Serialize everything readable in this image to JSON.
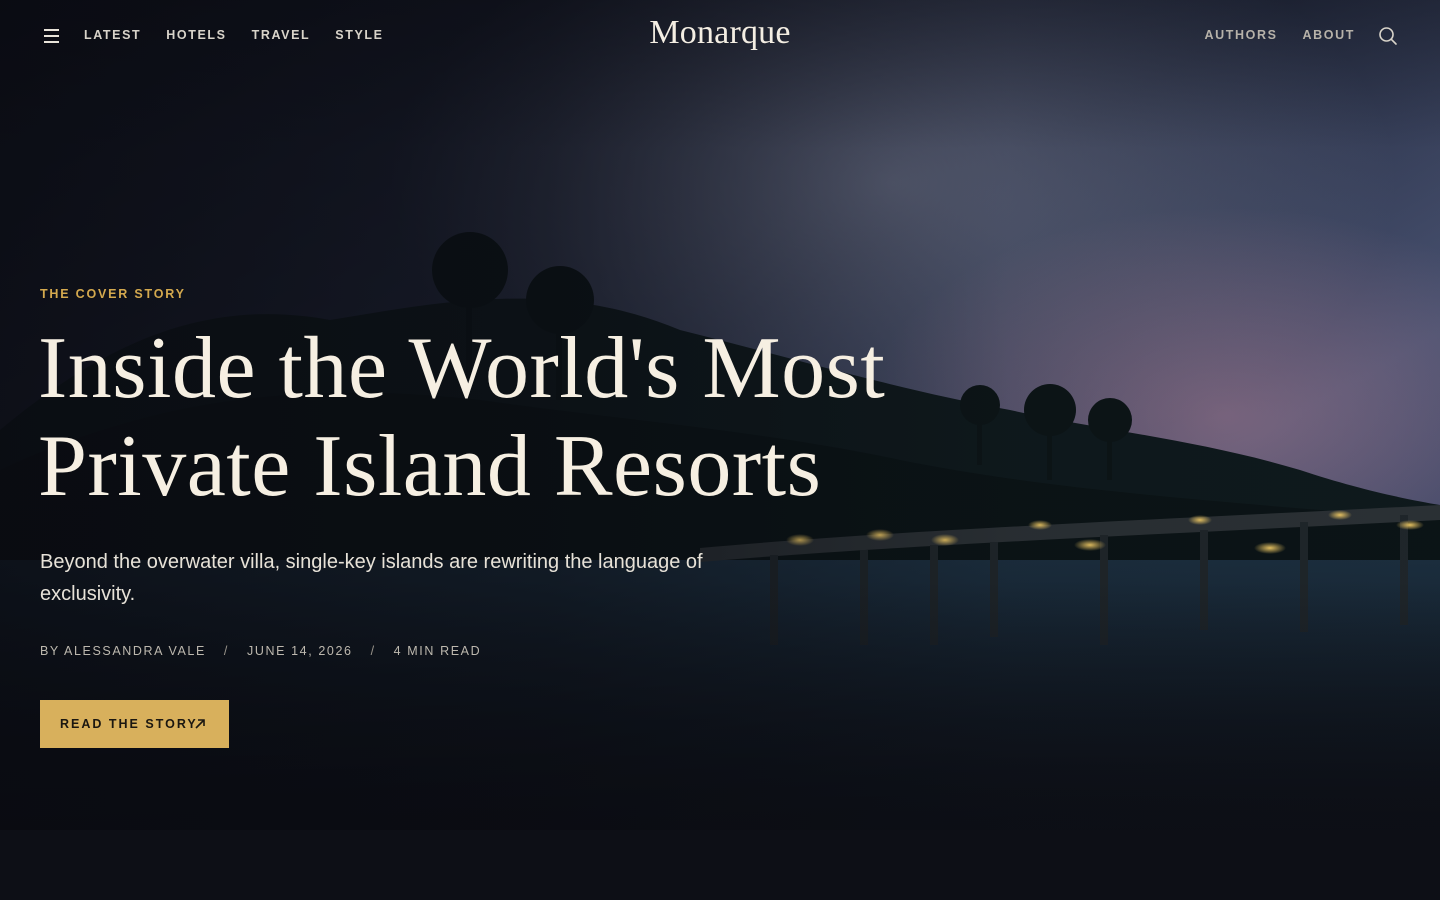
{
  "site": {
    "logo": "Monarque"
  },
  "nav": {
    "left_items": [
      {
        "label": "LATEST"
      },
      {
        "label": "HOTELS"
      },
      {
        "label": "TRAVEL"
      },
      {
        "label": "STYLE"
      }
    ],
    "right_items": [
      {
        "label": "AUTHORS"
      },
      {
        "label": "ABOUT"
      }
    ],
    "menu_icon": "hamburger-menu-icon",
    "search_icon": "search-icon"
  },
  "hero": {
    "kicker": "THE COVER STORY",
    "headline_line1": "Inside the World's Most",
    "headline_line2": "Private Island Resorts",
    "dek": "Beyond the overwater villa, single-key islands are rewriting the language of exclusivity.",
    "meta": {
      "author": "BY ALESSANDRA VALE",
      "date": "JUNE 14, 2026",
      "read_time": "4 MIN READ",
      "separator": "/"
    },
    "cta_label": "READ THE STORY",
    "cta_icon": "arrow-up-right-icon"
  },
  "colors": {
    "accent": "#D8B05C",
    "kicker": "#D4A94E",
    "headline": "#F6EFE2",
    "background": "#0D0F16"
  }
}
